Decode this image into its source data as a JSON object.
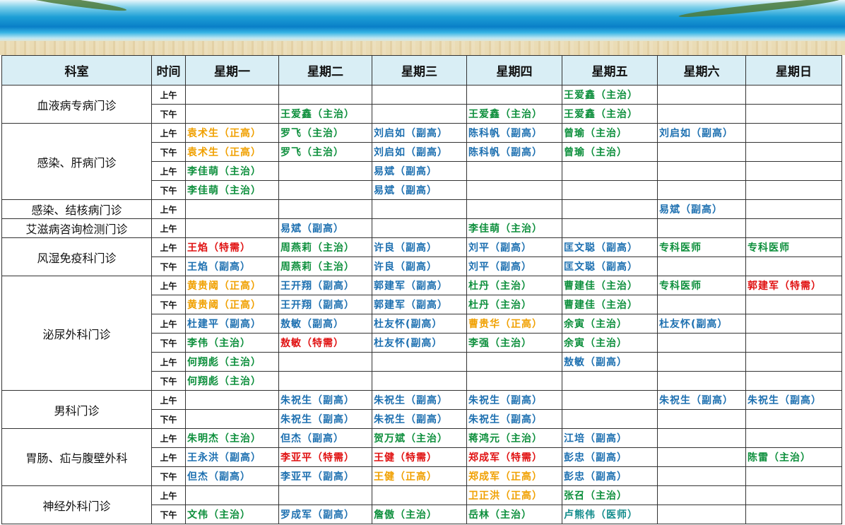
{
  "colors": {
    "orange": "#f0a000",
    "green": "#0d8f3c",
    "blue": "#1c6fb0",
    "red": "#e01010",
    "teal": "#138c8c",
    "header_bg": "#d9eef5"
  },
  "headers": [
    "科室",
    "时间",
    "星期一",
    "星期二",
    "星期三",
    "星期四",
    "星期五",
    "星期六",
    "星期日"
  ],
  "departments": [
    {
      "name": "血液病专病门诊",
      "rows": [
        {
          "time": "上午",
          "cells": [
            null,
            null,
            null,
            null,
            {
              "t": "王爱鑫（主治）",
              "c": "green"
            },
            null,
            null
          ]
        },
        {
          "time": "下午",
          "cells": [
            null,
            {
              "t": "王爱鑫（主治）",
              "c": "green"
            },
            null,
            {
              "t": "王爱鑫（主治）",
              "c": "green"
            },
            {
              "t": "王爱鑫（主治）",
              "c": "green"
            },
            null,
            null
          ]
        }
      ]
    },
    {
      "name": "感染、肝病门诊",
      "rows": [
        {
          "time": "上午",
          "cells": [
            {
              "t": "袁术生（正高）",
              "c": "orange"
            },
            {
              "t": "罗飞（主治）",
              "c": "green"
            },
            {
              "t": "刘启如（副高）",
              "c": "blue"
            },
            {
              "t": "陈科帆（副高）",
              "c": "blue"
            },
            {
              "t": "曾瑜（主治）",
              "c": "green"
            },
            {
              "t": "刘启如（副高）",
              "c": "blue"
            },
            null
          ]
        },
        {
          "time": "下午",
          "cells": [
            {
              "t": "袁术生（正高）",
              "c": "orange"
            },
            {
              "t": "罗飞（主治）",
              "c": "green"
            },
            {
              "t": "刘启如（副高）",
              "c": "blue"
            },
            {
              "t": "陈科帆（副高）",
              "c": "blue"
            },
            {
              "t": "曾瑜（主治）",
              "c": "green"
            },
            null,
            null
          ]
        },
        {
          "time": "上午",
          "cells": [
            {
              "t": "李佳萌（主治）",
              "c": "green"
            },
            null,
            {
              "t": "易斌（副高）",
              "c": "blue"
            },
            null,
            null,
            null,
            null
          ]
        },
        {
          "time": "下午",
          "cells": [
            {
              "t": "李佳萌（主治）",
              "c": "green"
            },
            null,
            {
              "t": "易斌（副高）",
              "c": "blue"
            },
            null,
            null,
            null,
            null
          ]
        }
      ]
    },
    {
      "name": "感染、结核病门诊",
      "rows": [
        {
          "time": "上午",
          "cells": [
            null,
            null,
            null,
            null,
            null,
            {
              "t": "易斌（副高）",
              "c": "blue"
            },
            null
          ]
        }
      ]
    },
    {
      "name": "艾滋病咨询检测门诊",
      "rows": [
        {
          "time": "上午",
          "cells": [
            null,
            {
              "t": "易斌（副高）",
              "c": "blue"
            },
            null,
            {
              "t": "李佳萌（主治）",
              "c": "green"
            },
            null,
            null,
            null
          ]
        }
      ]
    },
    {
      "name": "风湿免疫科门诊",
      "rows": [
        {
          "time": "上午",
          "cells": [
            {
              "t": "王焰（特需）",
              "c": "red"
            },
            {
              "t": "周燕莉（主治）",
              "c": "green"
            },
            {
              "t": "许良（副高）",
              "c": "blue"
            },
            {
              "t": "刘平（副高）",
              "c": "blue"
            },
            {
              "t": "匡文聪（副高）",
              "c": "blue"
            },
            {
              "t": "专科医师",
              "c": "green"
            },
            {
              "t": "专科医师",
              "c": "green"
            }
          ]
        },
        {
          "time": "下午",
          "cells": [
            {
              "t": "王焰（副高）",
              "c": "blue"
            },
            {
              "t": "周燕莉（主治）",
              "c": "green"
            },
            {
              "t": "许良（副高）",
              "c": "blue"
            },
            {
              "t": "刘平（副高）",
              "c": "blue"
            },
            {
              "t": "匡文聪（副高）",
              "c": "blue"
            },
            null,
            null
          ]
        }
      ]
    },
    {
      "name": "泌尿外科门诊",
      "rows": [
        {
          "time": "上午",
          "cells": [
            {
              "t": "黄贵阈（正高）",
              "c": "orange"
            },
            {
              "t": "王开翔（副高）",
              "c": "blue"
            },
            {
              "t": "郭建军（副高）",
              "c": "blue"
            },
            {
              "t": "杜丹（主治）",
              "c": "green"
            },
            {
              "t": "曹建佳（主治）",
              "c": "green"
            },
            {
              "t": "专科医师",
              "c": "green"
            },
            {
              "t": "郭建军（特需）",
              "c": "red"
            }
          ]
        },
        {
          "time": "下午",
          "cells": [
            {
              "t": "黄贵阈（正高）",
              "c": "orange"
            },
            {
              "t": "王开翔（副高）",
              "c": "blue"
            },
            {
              "t": "郭建军（副高）",
              "c": "blue"
            },
            {
              "t": "杜丹（主治）",
              "c": "green"
            },
            {
              "t": "曹建佳（主治）",
              "c": "green"
            },
            null,
            null
          ]
        },
        {
          "time": "上午",
          "cells": [
            {
              "t": "杜建平（副高）",
              "c": "blue"
            },
            {
              "t": "敖敏（副高）",
              "c": "blue"
            },
            {
              "t": "杜友怀(副高）",
              "c": "blue"
            },
            {
              "t": "曹贵华（正高）",
              "c": "orange"
            },
            {
              "t": "余寅（主治）",
              "c": "green"
            },
            {
              "t": "杜友怀(副高）",
              "c": "blue"
            },
            null
          ]
        },
        {
          "time": "下午",
          "cells": [
            {
              "t": "李伟（主治）",
              "c": "green"
            },
            {
              "t": "敖敏（特需）",
              "c": "red"
            },
            {
              "t": "杜友怀(副高）",
              "c": "blue"
            },
            {
              "t": "李强（主治）",
              "c": "green"
            },
            {
              "t": "余寅（主治）",
              "c": "green"
            },
            null,
            null
          ]
        },
        {
          "time": "上午",
          "cells": [
            {
              "t": "何翔彪（主治）",
              "c": "green"
            },
            null,
            null,
            null,
            {
              "t": "敖敏（副高）",
              "c": "blue"
            },
            null,
            null
          ]
        },
        {
          "time": "下午",
          "cells": [
            {
              "t": "何翔彪（主治）",
              "c": "green"
            },
            null,
            null,
            null,
            null,
            null,
            null
          ]
        }
      ]
    },
    {
      "name": "男科门诊",
      "rows": [
        {
          "time": "上午",
          "cells": [
            null,
            {
              "t": "朱祝生（副高）",
              "c": "blue"
            },
            {
              "t": "朱祝生（副高）",
              "c": "blue"
            },
            {
              "t": "朱祝生（副高）",
              "c": "blue"
            },
            null,
            {
              "t": " 朱祝生（副高）",
              "c": "blue"
            },
            {
              "t": " 朱祝生（副高）",
              "c": "blue"
            }
          ]
        },
        {
          "time": "下午",
          "cells": [
            null,
            {
              "t": "朱祝生（副高）",
              "c": "blue"
            },
            {
              "t": "朱祝生（副高）",
              "c": "blue"
            },
            {
              "t": "朱祝生（副高）",
              "c": "blue"
            },
            null,
            null,
            null
          ]
        }
      ]
    },
    {
      "name": "胃肠、疝与腹壁外科",
      "rows": [
        {
          "time": "上午",
          "cells": [
            {
              "t": "朱明杰（主治）",
              "c": "green"
            },
            {
              "t": "但杰（副高）",
              "c": "blue"
            },
            {
              "t": "贺万斌（主治）",
              "c": "green"
            },
            {
              "t": "蒋鸿元（主治）",
              "c": "green"
            },
            {
              "t": "江培（副高）",
              "c": "blue"
            },
            null,
            null
          ]
        },
        {
          "time": "上午",
          "cells": [
            {
              "t": "王永洪（副高）",
              "c": "blue"
            },
            {
              "t": "李亚平（特需）",
              "c": "red"
            },
            {
              "t": "王健（特需）",
              "c": "red"
            },
            {
              "t": "郑成军（特需）",
              "c": "red"
            },
            {
              "t": "彭忠（副高）",
              "c": "blue"
            },
            null,
            {
              "t": "陈雷（主治）",
              "c": "green"
            }
          ]
        },
        {
          "time": "下午",
          "cells": [
            {
              "t": "但杰（副高）",
              "c": "blue"
            },
            {
              "t": "李亚平（副高）",
              "c": "blue"
            },
            {
              "t": "王健（正高）",
              "c": "orange"
            },
            {
              "t": "郑成军（正高）",
              "c": "orange"
            },
            {
              "t": "彭忠（副高）",
              "c": "blue"
            },
            null,
            null
          ]
        }
      ]
    },
    {
      "name": "神经外科门诊",
      "rows": [
        {
          "time": "上午",
          "cells": [
            null,
            null,
            null,
            {
              "t": "卫正洪（正高）",
              "c": "orange"
            },
            {
              "t": "张召（主治）",
              "c": "green"
            },
            null,
            null
          ]
        },
        {
          "time": "下午",
          "cells": [
            {
              "t": "文伟（主治）",
              "c": "green"
            },
            {
              "t": "罗成军（副高）",
              "c": "blue"
            },
            {
              "t": "詹傲（主治）",
              "c": "green"
            },
            {
              "t": "岳林（主治）",
              "c": "green"
            },
            {
              "t": "卢熊伟（医师）",
              "c": "teal"
            },
            null,
            null
          ]
        }
      ]
    }
  ]
}
